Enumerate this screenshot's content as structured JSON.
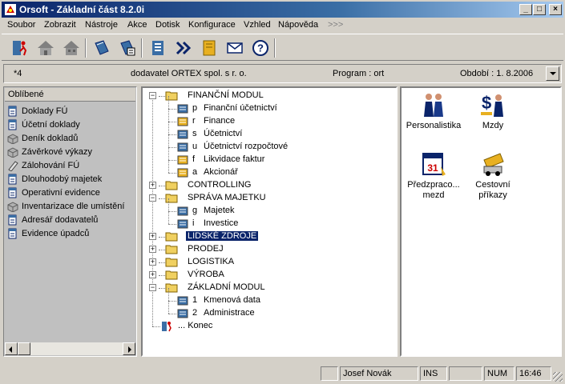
{
  "window": {
    "title": "Orsoft - Základní část 8.2.0i",
    "minimize": "_",
    "maximize": "□",
    "close": "×"
  },
  "menu": {
    "items": [
      "Soubor",
      "Zobrazit",
      "Nástroje",
      "Akce",
      "Dotisk",
      "Konfigurace",
      "Vzhled",
      "Nápověda"
    ],
    "more": ">>>"
  },
  "toolbar": {
    "icons": [
      "run-icon",
      "home-icon",
      "home-gray-icon",
      "book-icon",
      "book-list-icon",
      "list-icon",
      "fast-forward-icon",
      "notebook-icon",
      "mail-icon",
      "help-icon"
    ]
  },
  "info": {
    "left": "*4",
    "company": "dodavatel ORTEX spol. s r. o.",
    "program": "Program : ort",
    "period": "Období :  1. 8.2006"
  },
  "favorites": {
    "header": "Oblíbené",
    "items": [
      {
        "label": "Doklady FÚ",
        "icon": "doc-icon"
      },
      {
        "label": "Účetní doklady",
        "icon": "doc-icon"
      },
      {
        "label": "Deník dokladů",
        "icon": "box-icon"
      },
      {
        "label": "Závěrkové výkazy",
        "icon": "box-icon"
      },
      {
        "label": "Zálohování FÚ",
        "icon": "pencil-icon"
      },
      {
        "label": "Dlouhodobý majetek",
        "icon": "doc-icon"
      },
      {
        "label": "Operativní evidence",
        "icon": "doc-icon"
      },
      {
        "label": "Inventarizace dle umístění",
        "icon": "box-icon"
      },
      {
        "label": "Adresář dodavatelů",
        "icon": "doc-icon"
      },
      {
        "label": "Evidence úpadců",
        "icon": "doc-icon"
      }
    ]
  },
  "tree": {
    "nodes": [
      {
        "label": "FINANČNÍ MODUL",
        "key": "",
        "expander": "−",
        "level": 0
      },
      {
        "label": "Finanční účetnictví",
        "key": "p",
        "level": 1
      },
      {
        "label": "Finance",
        "key": "r",
        "level": 1
      },
      {
        "label": "Účetnictví",
        "key": "s",
        "level": 1
      },
      {
        "label": "Účetnictví rozpočtové",
        "key": "u",
        "level": 1
      },
      {
        "label": "Likvidace faktur",
        "key": "f",
        "level": 1
      },
      {
        "label": "Akcionář",
        "key": "a",
        "level": 1
      },
      {
        "label": "CONTROLLING",
        "key": "",
        "expander": "+",
        "level": 0
      },
      {
        "label": "SPRÁVA MAJETKU",
        "key": "",
        "expander": "−",
        "level": 0
      },
      {
        "label": "Majetek",
        "key": "g",
        "level": 1
      },
      {
        "label": "Investice",
        "key": "i",
        "level": 1
      },
      {
        "label": "LIDSKÉ ZDROJE",
        "key": "",
        "expander": "+",
        "level": 0,
        "selected": true
      },
      {
        "label": "PRODEJ",
        "key": "",
        "expander": "+",
        "level": 0
      },
      {
        "label": "LOGISTIKA",
        "key": "",
        "expander": "+",
        "level": 0
      },
      {
        "label": "VÝROBA",
        "key": "",
        "expander": "+",
        "level": 0
      },
      {
        "label": "ZÁKLADNÍ MODUL",
        "key": "",
        "expander": "−",
        "level": 0
      },
      {
        "label": "Kmenová data",
        "key": "1",
        "level": 1
      },
      {
        "label": "Administrace",
        "key": "2",
        "level": 1
      },
      {
        "label": "... Konec",
        "key": "",
        "level": 0,
        "exit": true
      }
    ]
  },
  "modules": [
    {
      "label": "Personalistika",
      "icon": "people-icon",
      "selected": true
    },
    {
      "label": "Mzdy",
      "icon": "money-icon"
    },
    {
      "label": "Předzpraco... mezd",
      "icon": "calendar-icon"
    },
    {
      "label": "Cestovní příkazy",
      "icon": "car-icon"
    }
  ],
  "status": {
    "user": "Josef Novák",
    "ins": "INS",
    "num": "NUM",
    "time": "16:46"
  }
}
